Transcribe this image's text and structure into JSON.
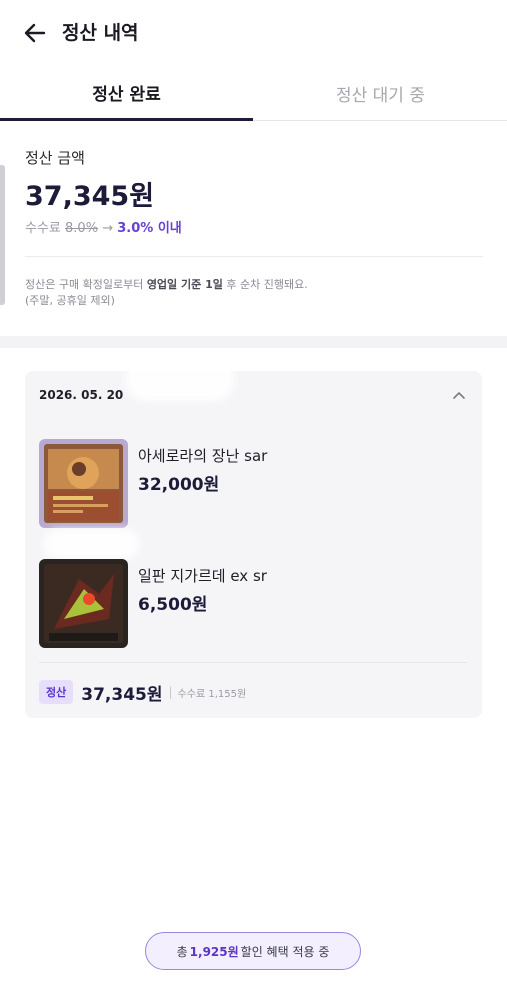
{
  "header": {
    "title": "정산 내역"
  },
  "tabs": [
    {
      "label": "정산 완료",
      "active": true
    },
    {
      "label": "정산 대기 중",
      "active": false
    }
  ],
  "summary": {
    "label": "정산 금액",
    "amount": "37,345원",
    "fee_prefix": "수수료",
    "fee_old": "8.0%",
    "fee_arrow": "→",
    "fee_new": "3.0% 이내",
    "notice_part1": "정산은 구매 확정일로부터 ",
    "notice_bold": "영업일 기준 1일",
    "notice_part2": " 후 순차 진행돼요.",
    "notice_line2": "(주말, 공휴일 제외)"
  },
  "card": {
    "date": "2026. 05. 20",
    "items": [
      {
        "name": "아세로라의 장난 sar",
        "price": "32,000원"
      },
      {
        "name": "일판 지가르데 ex sr",
        "price": "6,500원"
      }
    ],
    "footer": {
      "badge": "정산",
      "amount": "37,345원",
      "separator": "|",
      "fee": "수수료 1,155원"
    }
  },
  "discount": {
    "prefix": "총",
    "amount": "1,925원",
    "suffix": "할인 혜택 적용 중"
  },
  "colors": {
    "accent": "#6a3fd6",
    "badge_bg": "#e6defa",
    "text_dark": "#1c1b3a"
  },
  "icons": [
    "back-arrow-icon",
    "chevron-up-icon"
  ]
}
